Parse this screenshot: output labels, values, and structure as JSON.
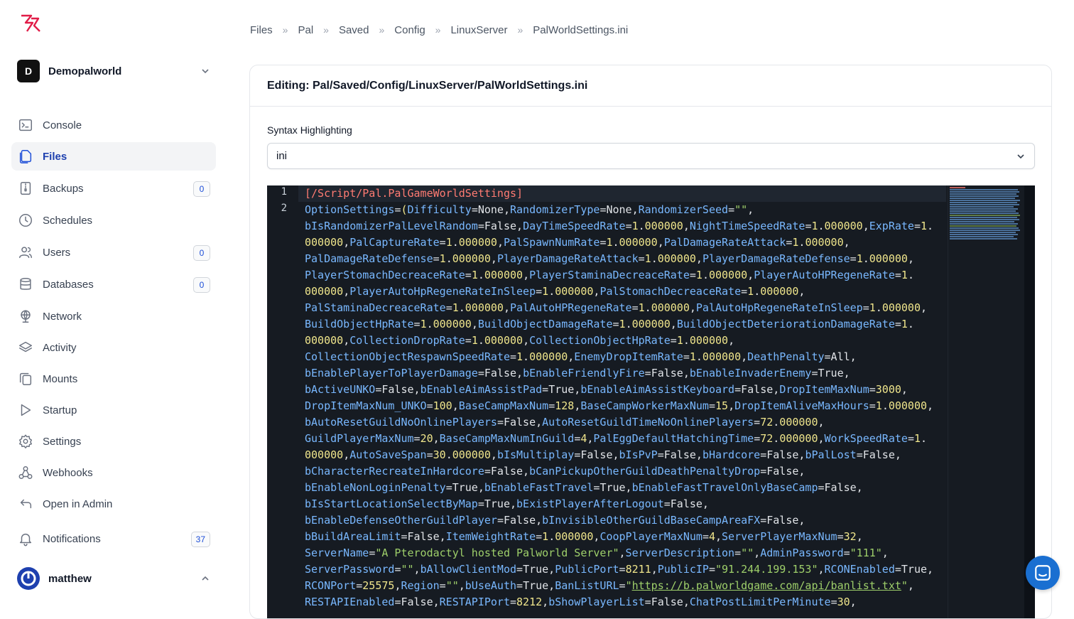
{
  "sidebar": {
    "server": {
      "initial": "D",
      "name": "Demopalworld"
    },
    "items": [
      {
        "label": "Console"
      },
      {
        "label": "Files"
      },
      {
        "label": "Backups",
        "badge": "0"
      },
      {
        "label": "Schedules"
      },
      {
        "label": "Users",
        "badge": "0"
      },
      {
        "label": "Databases",
        "badge": "0"
      },
      {
        "label": "Network"
      },
      {
        "label": "Activity"
      },
      {
        "label": "Mounts"
      },
      {
        "label": "Startup"
      },
      {
        "label": "Settings"
      },
      {
        "label": "Webhooks"
      },
      {
        "label": "Open in Admin"
      },
      {
        "label": "Notifications",
        "badge": "37"
      }
    ],
    "user": {
      "name": "matthew"
    }
  },
  "breadcrumb": [
    "Files",
    "Pal",
    "Saved",
    "Config",
    "LinuxServer",
    "PalWorldSettings.ini"
  ],
  "editor_card": {
    "title": "Editing: Pal/Saved/Config/LinuxServer/PalWorldSettings.ini",
    "syntax_label": "Syntax Highlighting",
    "syntax_value": "ini",
    "line_numbers": [
      "1",
      "2"
    ],
    "section_header": "[/Script/Pal.PalGameWorldSettings]"
  }
}
